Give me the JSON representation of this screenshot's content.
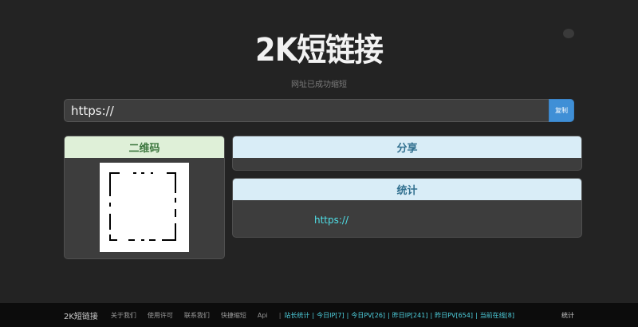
{
  "app": {
    "title": "2K短链接",
    "subtitle": "网址已成功缩短"
  },
  "url_bar": {
    "value": "https://",
    "button_label": "复制"
  },
  "panels": {
    "qr_title": "二维码",
    "share_title": "分享",
    "stats_title": "统计",
    "stats_link": "https://"
  },
  "footer": {
    "brand": "2K短链接",
    "links": [
      "关于我们",
      "使用许可",
      "联系我们",
      "快捷缩短",
      "Api"
    ],
    "separator": "|",
    "stats": [
      "站长统计",
      "今日IP[7]",
      "今日PV[26]",
      "昨日IP[241]",
      "昨日PV[654]",
      "当前在线[8]"
    ],
    "right_label": "统计"
  },
  "colors": {
    "background": "#232323",
    "accent_button": "#3f8fd6",
    "qr_header": "#dff0d8",
    "info_header": "#d9edf7",
    "link": "#4fe0e8"
  }
}
